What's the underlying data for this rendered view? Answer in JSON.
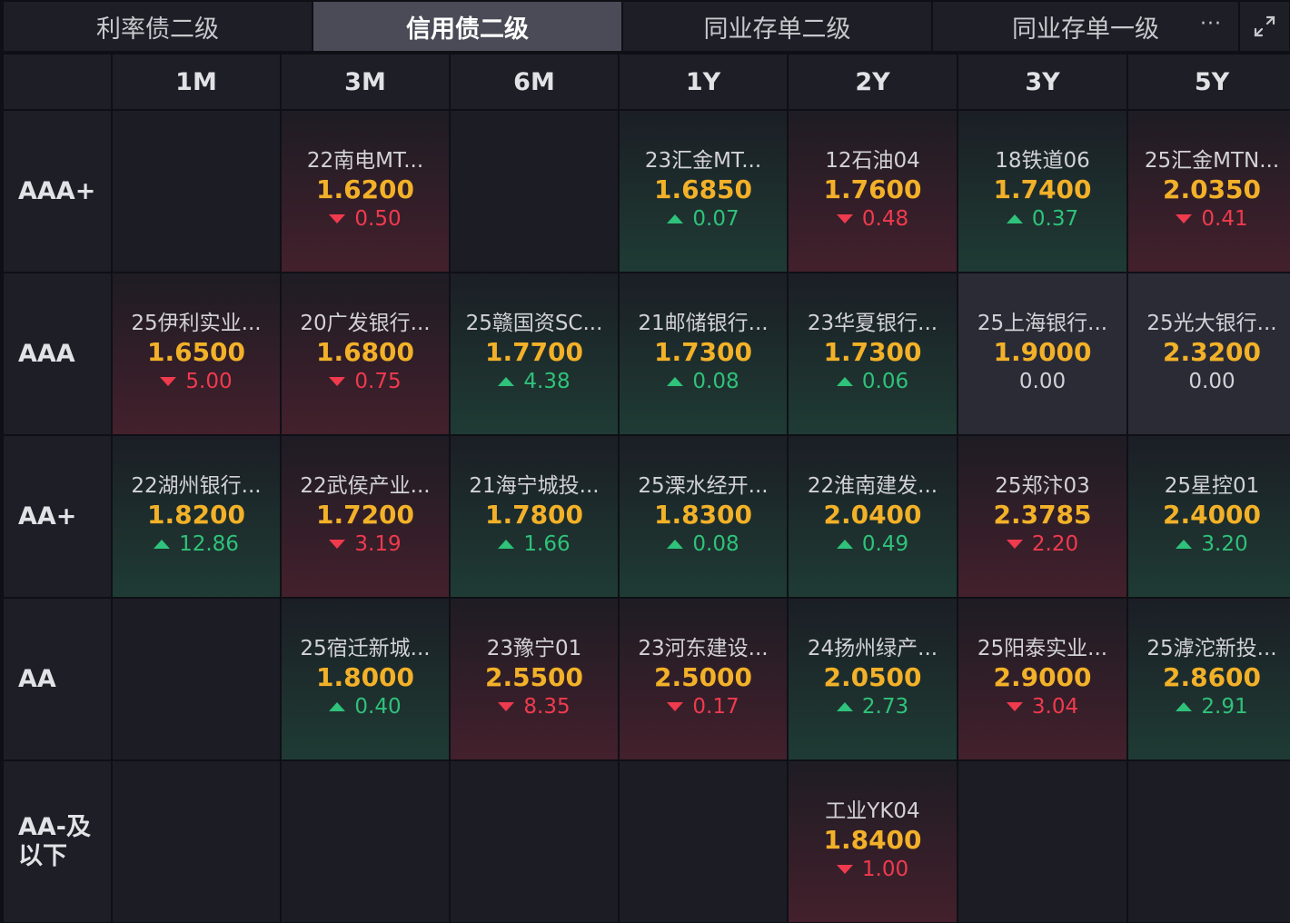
{
  "tabs": [
    {
      "label": "利率债二级",
      "active": false
    },
    {
      "label": "信用债二级",
      "active": true
    },
    {
      "label": "同业存单二级",
      "active": false
    },
    {
      "label": "同业存单一级",
      "active": false
    }
  ],
  "more_label": "···",
  "columns": [
    "1M",
    "3M",
    "6M",
    "1Y",
    "2Y",
    "3Y",
    "5Y"
  ],
  "rows": [
    {
      "label_lines": [
        "AAA+"
      ],
      "cells": [
        null,
        {
          "name": "22南电MT...",
          "rate": "1.6200",
          "change": "0.50",
          "dir": "down"
        },
        null,
        {
          "name": "23汇金MT...",
          "rate": "1.6850",
          "change": "0.07",
          "dir": "up"
        },
        {
          "name": "12石油04",
          "rate": "1.7600",
          "change": "0.48",
          "dir": "down"
        },
        {
          "name": "18铁道06",
          "rate": "1.7400",
          "change": "0.37",
          "dir": "up"
        },
        {
          "name": "25汇金MTN...",
          "rate": "2.0350",
          "change": "0.41",
          "dir": "down"
        }
      ]
    },
    {
      "label_lines": [
        "AAA"
      ],
      "cells": [
        {
          "name": "25伊利实业...",
          "rate": "1.6500",
          "change": "5.00",
          "dir": "down"
        },
        {
          "name": "20广发银行...",
          "rate": "1.6800",
          "change": "0.75",
          "dir": "down"
        },
        {
          "name": "25赣国资SC...",
          "rate": "1.7700",
          "change": "4.38",
          "dir": "up"
        },
        {
          "name": "21邮储银行...",
          "rate": "1.7300",
          "change": "0.08",
          "dir": "up"
        },
        {
          "name": "23华夏银行...",
          "rate": "1.7300",
          "change": "0.06",
          "dir": "up"
        },
        {
          "name": "25上海银行...",
          "rate": "1.9000",
          "change": "0.00",
          "dir": "flat"
        },
        {
          "name": "25光大银行...",
          "rate": "2.3200",
          "change": "0.00",
          "dir": "flat"
        }
      ]
    },
    {
      "label_lines": [
        "AA+"
      ],
      "cells": [
        {
          "name": "22湖州银行...",
          "rate": "1.8200",
          "change": "12.86",
          "dir": "up"
        },
        {
          "name": "22武侯产业...",
          "rate": "1.7200",
          "change": "3.19",
          "dir": "down"
        },
        {
          "name": "21海宁城投...",
          "rate": "1.7800",
          "change": "1.66",
          "dir": "up"
        },
        {
          "name": "25溧水经开...",
          "rate": "1.8300",
          "change": "0.08",
          "dir": "up"
        },
        {
          "name": "22淮南建发...",
          "rate": "2.0400",
          "change": "0.49",
          "dir": "up"
        },
        {
          "name": "25郑汴03",
          "rate": "2.3785",
          "change": "2.20",
          "dir": "down"
        },
        {
          "name": "25星控01",
          "rate": "2.4000",
          "change": "3.20",
          "dir": "up"
        }
      ]
    },
    {
      "label_lines": [
        "AA"
      ],
      "cells": [
        null,
        {
          "name": "25宿迁新城...",
          "rate": "1.8000",
          "change": "0.40",
          "dir": "up"
        },
        {
          "name": "23豫宁01",
          "rate": "2.5500",
          "change": "8.35",
          "dir": "down"
        },
        {
          "name": "23河东建设...",
          "rate": "2.5000",
          "change": "0.17",
          "dir": "down"
        },
        {
          "name": "24扬州绿产...",
          "rate": "2.0500",
          "change": "2.73",
          "dir": "up"
        },
        {
          "name": "25阳泰实业...",
          "rate": "2.9000",
          "change": "3.04",
          "dir": "down"
        },
        {
          "name": "25滹沱新投...",
          "rate": "2.8600",
          "change": "2.91",
          "dir": "up"
        }
      ]
    },
    {
      "label_lines": [
        "AA-及",
        "以下"
      ],
      "cells": [
        null,
        null,
        null,
        null,
        {
          "name": "工业YK04",
          "rate": "1.8400",
          "change": "1.00",
          "dir": "down"
        },
        null,
        null
      ]
    }
  ],
  "colors": {
    "rate": "#f2b128",
    "up": "#2fc27a",
    "down": "#f03a4e",
    "active_tab": "#4a4b57"
  },
  "icons": {
    "more": "more-dots-icon",
    "expand": "expand-icon"
  }
}
